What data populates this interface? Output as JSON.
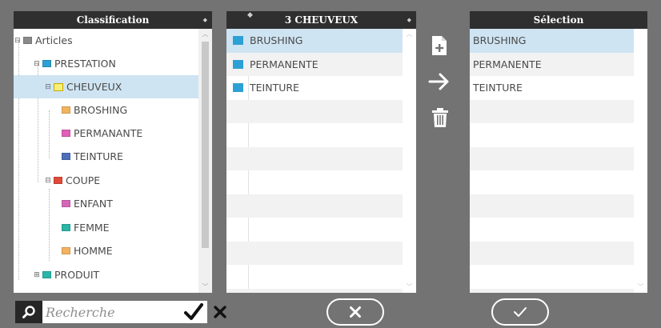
{
  "tree": {
    "header": "Classification",
    "rows": [
      {
        "label": "Articles",
        "swatch": "#8a8a8a",
        "toggle": "⊟"
      },
      {
        "label": "PRESTATION",
        "swatch": "#2da0d4",
        "toggle": "⊟"
      },
      {
        "label": "CHEUVEUX",
        "swatch": "#f5f07a",
        "toggle": "⊟",
        "selected": true,
        "folder": true
      },
      {
        "label": "BROSHING",
        "swatch": "#f2b35e"
      },
      {
        "label": "PERMANANTE",
        "swatch": "#e05fb8"
      },
      {
        "label": "TEINTURE",
        "swatch": "#4c6fb8"
      },
      {
        "label": "COUPE",
        "swatch": "#e04a3a",
        "toggle": "⊟"
      },
      {
        "label": "ENFANT",
        "swatch": "#d468b8"
      },
      {
        "label": "FEMME",
        "swatch": "#2bb5a8"
      },
      {
        "label": "HOMME",
        "swatch": "#f2b35e"
      },
      {
        "label": "PRODUIT",
        "swatch": "#2bb5a8",
        "toggle": "⊞"
      }
    ]
  },
  "list": {
    "header": "3 CHEUVEUX",
    "items": [
      "BRUSHING",
      "PERMANENTE",
      "TEINTURE"
    ]
  },
  "selection": {
    "header": "Sélection",
    "items": [
      "BRUSHING",
      "PERMANENTE",
      "TEINTURE"
    ]
  },
  "search": {
    "placeholder": "Recherche"
  },
  "colors": {
    "background": "#737373",
    "header": "#2f2f2f",
    "selected_row": "#cfe4f2",
    "item_swatch": "#2da0d4"
  }
}
